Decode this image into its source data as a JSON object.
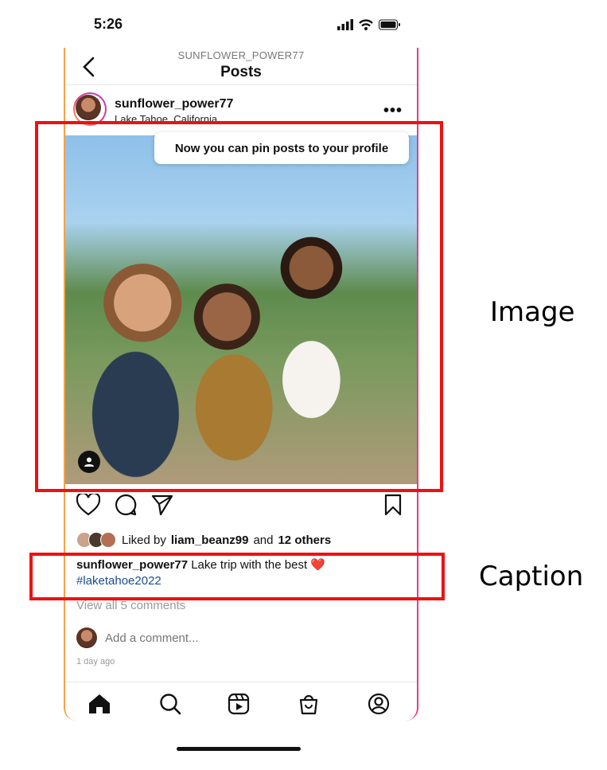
{
  "status_bar": {
    "time": "5:26"
  },
  "header": {
    "username": "SUNFLOWER_POWER77",
    "title": "Posts"
  },
  "post": {
    "username": "sunflower_power77",
    "location": "Lake Tahoe, California",
    "tooltip": "Now you can pin posts to your profile",
    "liked_prefix": "Liked by",
    "liked_user": "liam_beanz99",
    "liked_and": "and",
    "liked_others": "12 others",
    "caption_user": "sunflower_power77",
    "caption_text": "Lake trip with the best ❤️",
    "hashtag": "#laketahoe2022",
    "view_comments": "View all 5 comments",
    "comment_placeholder": "Add a comment...",
    "time_ago": "1 day ago"
  },
  "annotations": {
    "image_label": "Image",
    "caption_label": "Caption"
  },
  "icons": {
    "back": "chevron-left-icon",
    "more": "more-icon",
    "like": "heart-icon",
    "comment": "comment-icon",
    "share": "send-icon",
    "save": "bookmark-icon",
    "tag": "person-tag-icon",
    "home": "home-icon",
    "search": "search-icon",
    "reels": "reels-icon",
    "shop": "shop-icon",
    "profile": "profile-icon"
  },
  "colors": {
    "highlight": "#ee1111",
    "hashtag": "#1d4c8f",
    "ring_start": "#f9a14a",
    "ring_end": "#e23c8e"
  }
}
